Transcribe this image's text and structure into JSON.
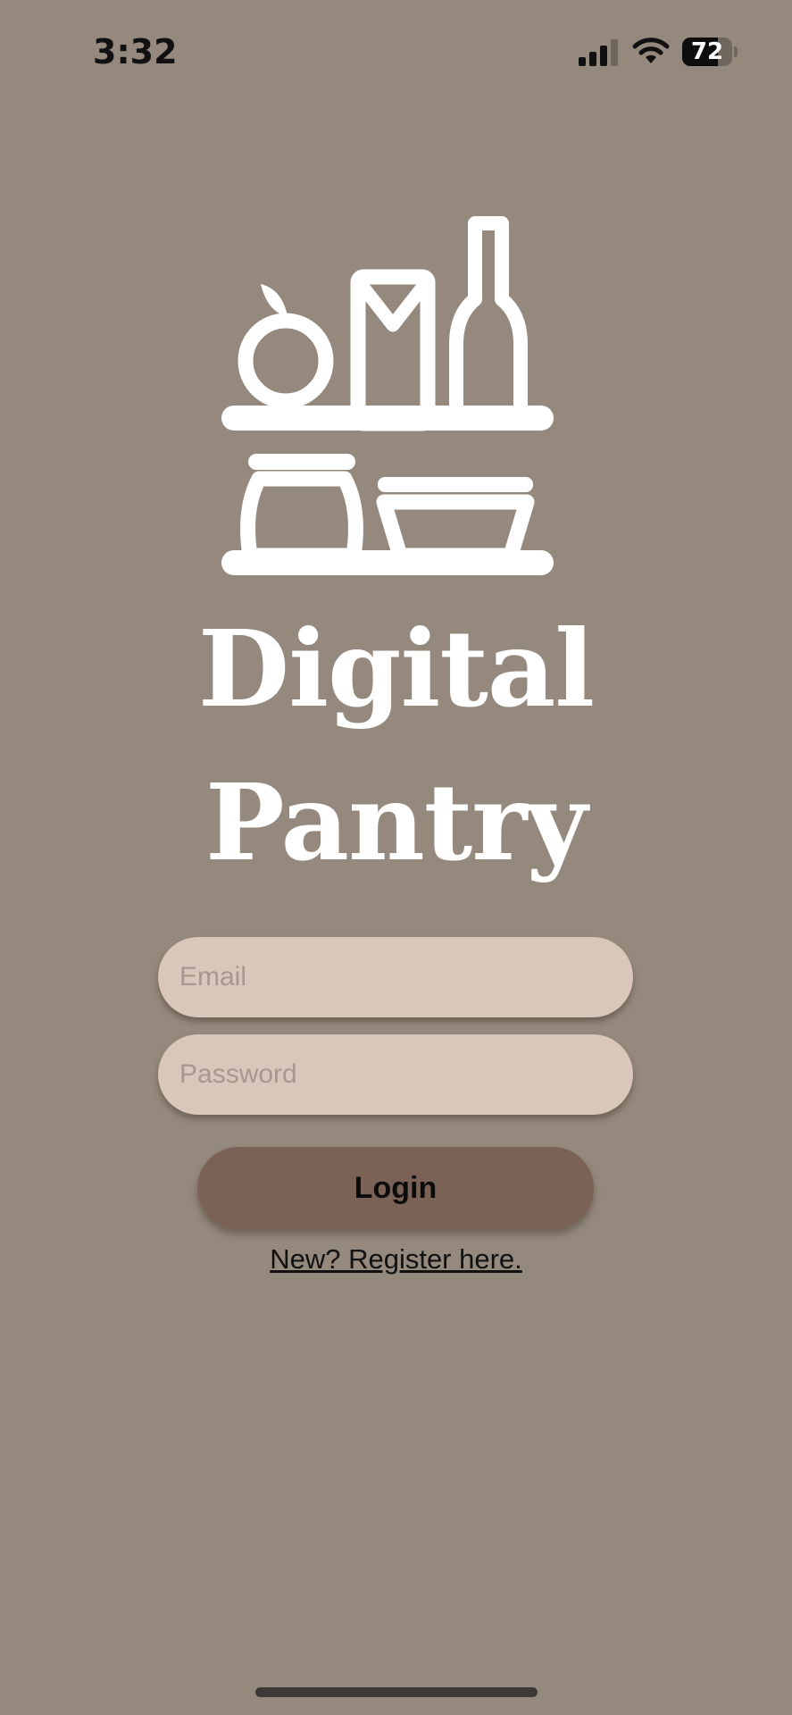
{
  "status_bar": {
    "time": "3:32",
    "battery_level": 72,
    "battery_text": "72"
  },
  "branding": {
    "line1": "Digital",
    "line2": "Pantry",
    "logo_icon": "pantry-shelf-icon"
  },
  "login_form": {
    "email_placeholder": "Email",
    "email_value": "",
    "password_placeholder": "Password",
    "password_value": "",
    "login_label": "Login",
    "register_link": "New? Register here."
  },
  "colors": {
    "background": "#95897d",
    "field_background": "#d9c7bc",
    "button_background": "#7a6356",
    "logo": "#ffffff"
  }
}
